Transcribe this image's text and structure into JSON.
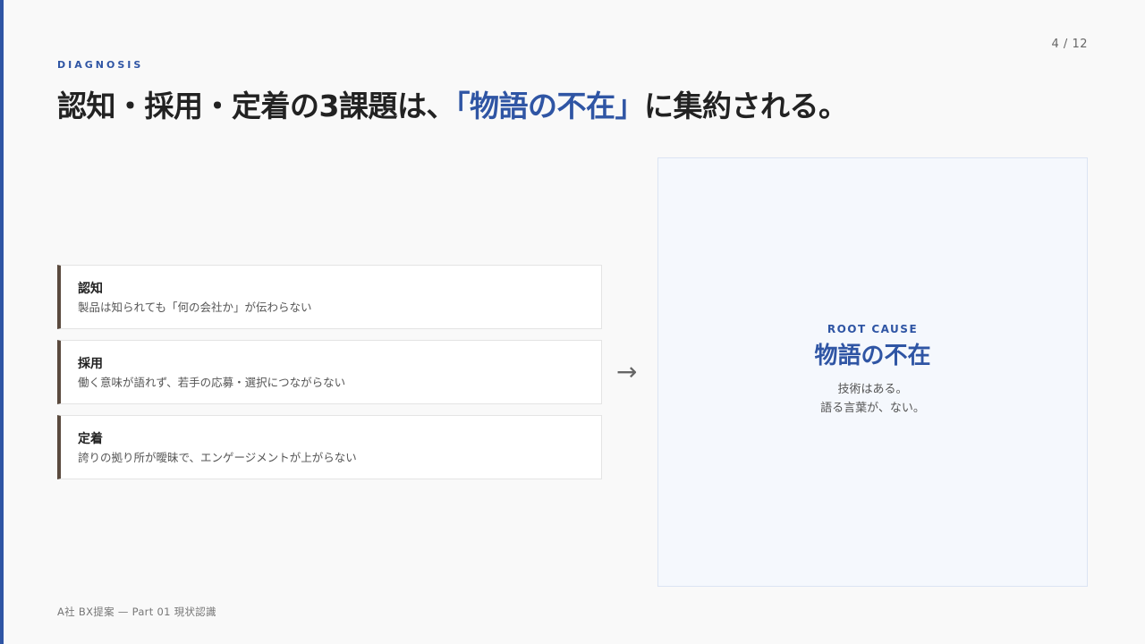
{
  "page_number": "4 / 12",
  "eyebrow": "DIAGNOSIS",
  "headline": {
    "before": "認知・採用・定着の3課題は、",
    "highlight": "「物語の不在」",
    "after": "に集約される。"
  },
  "issues": [
    {
      "title": "認知",
      "description": "製品は知られても「何の会社か」が伝わらない"
    },
    {
      "title": "採用",
      "description": "働く意味が語れず、若手の応募・選択につながらない"
    },
    {
      "title": "定着",
      "description": "誇りの拠り所が曖昧で、エンゲージメントが上がらない"
    }
  ],
  "arrow": "→",
  "root_cause": {
    "kicker": "ROOT CAUSE",
    "title": "物語の不在",
    "line1": "技術はある。",
    "line2": "語る言葉が、ない。"
  },
  "footer": "A社 BX提案 — Part 01 現状認識",
  "colors": {
    "accent": "#2f55a4",
    "card_border": "#5a4a3e",
    "panel_bg": "#f5f8fd"
  }
}
